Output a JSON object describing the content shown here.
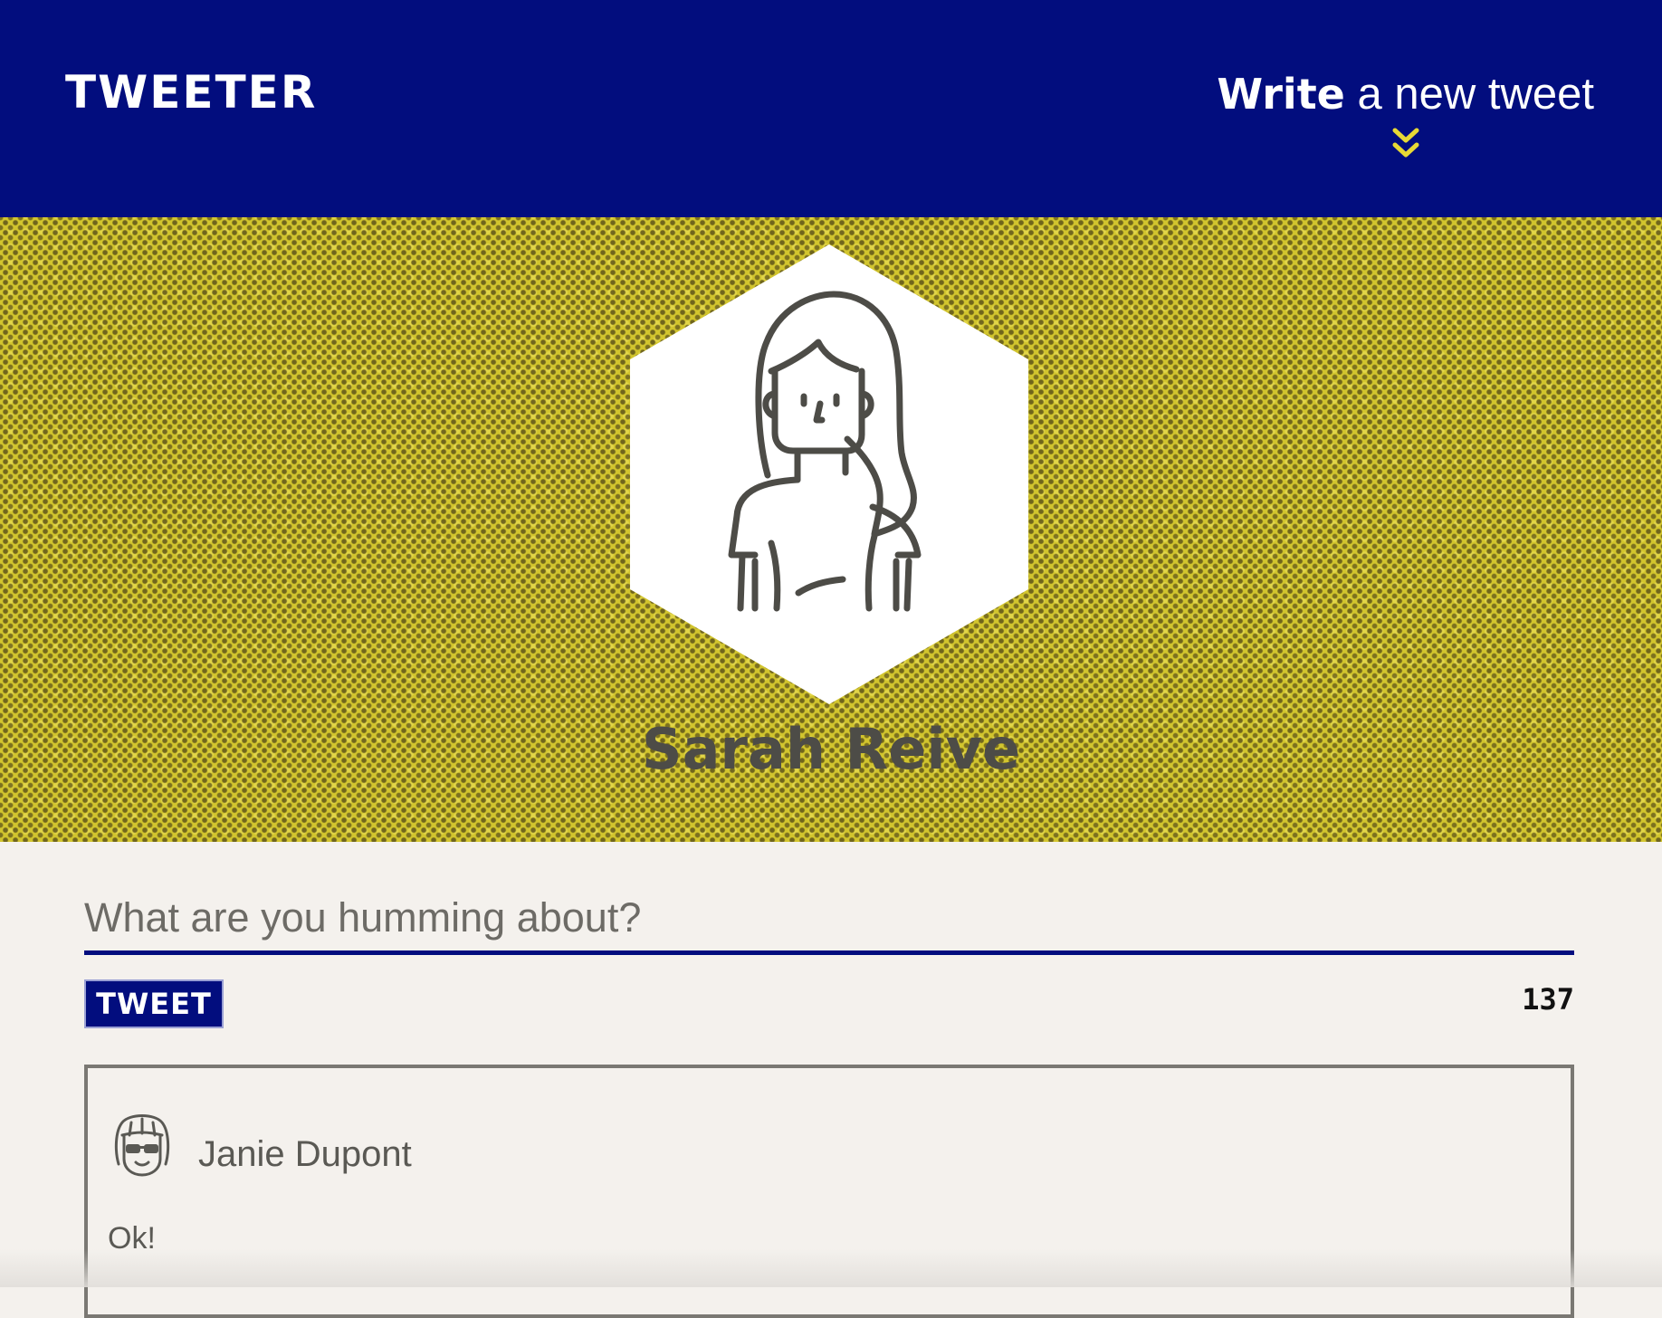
{
  "header": {
    "brand": "TWEETER",
    "compose_toggle": {
      "strong": "Write",
      "rest": " a new tweet",
      "icon": "double-chevron-down-icon"
    }
  },
  "profile": {
    "name": "Sarah Reive",
    "avatar_icon": "woman-avatar-icon"
  },
  "composer": {
    "placeholder": "What are you humming about?",
    "value": "",
    "button_label": "TWEET",
    "char_counter": "137"
  },
  "tweets": [
    {
      "author": "Janie Dupont",
      "avatar_icon": "girl-with-sunglasses-avatar-icon",
      "text": "Ok!"
    }
  ],
  "colors": {
    "navy": "#020d7e",
    "mustard": "#d2c52e",
    "chevron_yellow": "#e8d935",
    "page_bg": "#f4f1ed",
    "ink_gray": "#4d4c47"
  }
}
